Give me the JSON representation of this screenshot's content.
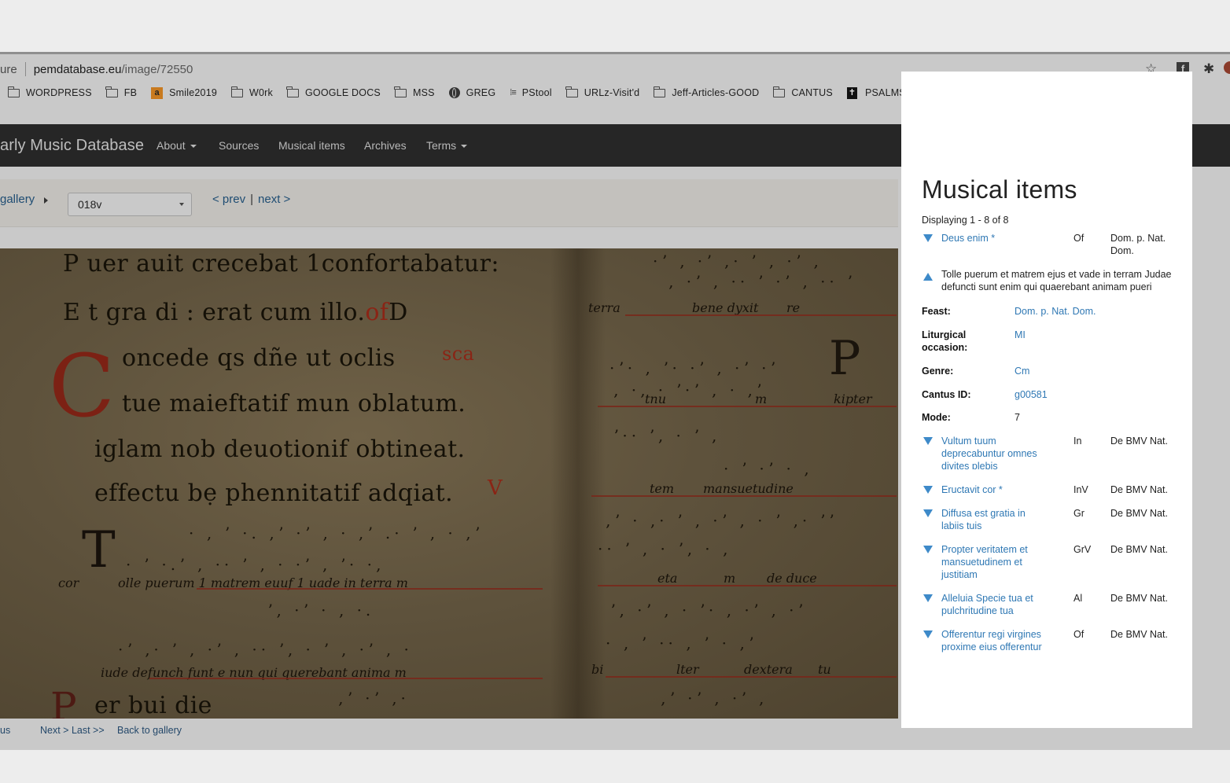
{
  "browser": {
    "url_prefix": "ure",
    "url_domain": "pemdatabase.eu",
    "url_path": "/image/72550",
    "bookmarks": [
      {
        "label": "WORDPRESS",
        "icon": "folder-icon"
      },
      {
        "label": "FB",
        "icon": "folder-icon"
      },
      {
        "label": "Smile2019",
        "icon": "amazon-icon"
      },
      {
        "label": "W0rk",
        "icon": "folder-icon"
      },
      {
        "label": "GOOGLE DOCS",
        "icon": "folder-icon"
      },
      {
        "label": "MSS",
        "icon": "folder-icon"
      },
      {
        "label": "GREG",
        "icon": "globe-icon"
      },
      {
        "label": "PStool",
        "icon": "pstool-icon"
      },
      {
        "label": "URLz-Visit'd",
        "icon": "folder-icon"
      },
      {
        "label": "Jeff-Articles-GOOD",
        "icon": "folder-icon"
      },
      {
        "label": "CANTUS",
        "icon": "folder-icon"
      },
      {
        "label": "PSALMS",
        "icon": "cross-icon"
      }
    ]
  },
  "site": {
    "brand": "arly Music Database",
    "nav": {
      "about": "About",
      "sources": "Sources",
      "musical_items": "Musical items",
      "archives": "Archives",
      "terms": "Terms"
    }
  },
  "toolbar": {
    "gallery": "gallery",
    "folio": "018v",
    "prev": "< prev",
    "separator": "|",
    "next": "next >"
  },
  "manuscript": {
    "lines": [
      "P uer auit crecebat 1confortabatur:",
      "E t gra di : erat cum illo.",
      "oncede qs dñe ut oclis",
      "tue maieftatif mun oblatum.",
      "iglam nob deuotionif obtineat.",
      "effectu bẹ phennitatif adqiat.",
      "olle puerum  1 matrem  euuf 1 uade  in terra m",
      "iude defunch funt e  nun qui querebant anima m",
      "er bui die"
    ],
    "red_marks": [
      "of",
      "D",
      "sca",
      "V",
      "cor"
    ],
    "right_words": [
      "terra",
      "bene dyxit",
      "re",
      "tnu",
      "m",
      "kipter",
      "tem",
      "mansuetudine",
      "eta",
      "m",
      "de duce",
      "bi",
      "lter",
      "dextera",
      "tu"
    ]
  },
  "footer": {
    "prev_frag": "us",
    "next_last": "Next > Last >>",
    "back": "Back to gallery"
  },
  "panel": {
    "title": "Musical items",
    "count": "Displaying 1 - 8 of 8",
    "items": [
      {
        "title": "Deus enim *",
        "genre": "Of",
        "feast": "Dom. p. Nat. Dom."
      },
      {
        "title": "Vultum tuum deprecabuntur omnes divites plebis",
        "genre": "In",
        "feast": "De BMV Nat."
      },
      {
        "title": "Eructavit cor *",
        "genre": "InV",
        "feast": "De BMV Nat."
      },
      {
        "title": "Diffusa est gratia in labiis tuis",
        "genre": "Gr",
        "feast": "De BMV Nat."
      },
      {
        "title": "Propter veritatem et mansuetudinem et justitiam",
        "genre": "GrV",
        "feast": "De BMV Nat."
      },
      {
        "title": "Alleluia Specie tua et pulchritudine tua",
        "genre": "Al",
        "feast": "De BMV Nat."
      },
      {
        "title": "Offerentur regi virgines proxime eius offerentur",
        "genre": "Of",
        "feast": "De BMV Nat."
      }
    ],
    "expanded": {
      "incipit": "Tolle puerum et matrem ejus et vade in terram Judae defuncti sunt enim qui quaerebant animam pueri",
      "feast_label": "Feast:",
      "feast": "Dom. p. Nat. Dom.",
      "occasion_label": "Liturgical occasion:",
      "occasion": "MI",
      "genre_label": "Genre:",
      "genre": "Cm",
      "cantus_label": "Cantus ID:",
      "cantus": "g00581",
      "mode_label": "Mode:",
      "mode": "7"
    }
  },
  "colors": {
    "panel_link": "#2f78b4",
    "triangle": "#3e8ac9",
    "navbar": "#262626",
    "rubric_red": "#8a2415"
  }
}
